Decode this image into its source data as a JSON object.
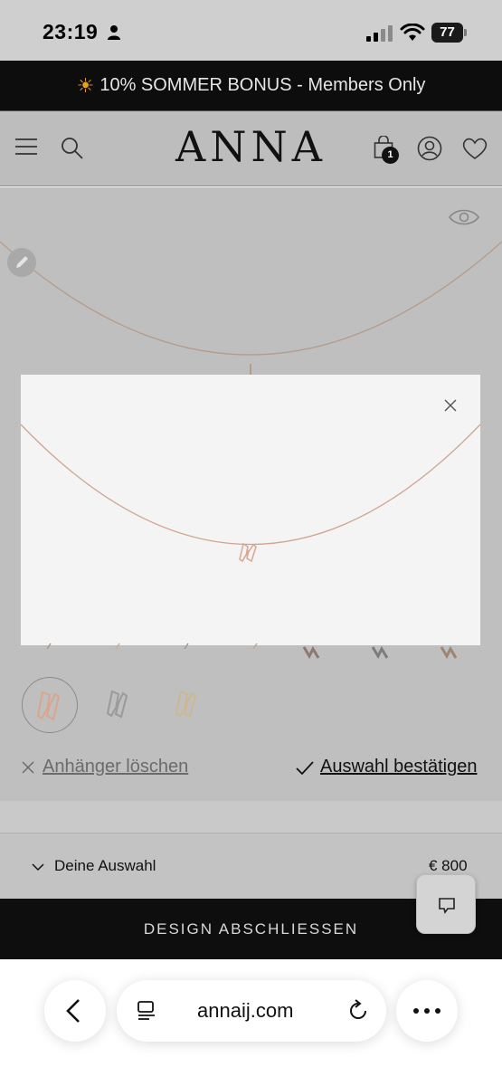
{
  "status_bar": {
    "time": "23:19",
    "battery": "77"
  },
  "promo": {
    "text": "10% SOMMER BONUS - Members Only"
  },
  "header": {
    "logo": "ANNA",
    "cart_count": "1"
  },
  "actions": {
    "delete_label": "Anhänger löschen",
    "confirm_label": "Auswahl bestätigen"
  },
  "summary": {
    "label": "Deine Auswahl",
    "price": "€ 800"
  },
  "cta": {
    "label": "DESIGN ABSCHLIESSEN"
  },
  "browser": {
    "url": "annaij.com"
  },
  "colors": {
    "chain": "#c9a38a",
    "pendant_rose": "#d9a68c",
    "pendant_silver": "#9a9a9a",
    "pendant_gold": "#cbb892",
    "promo_sun": "#e8a21a"
  }
}
